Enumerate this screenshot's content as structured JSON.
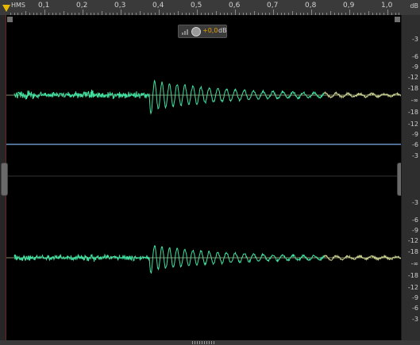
{
  "ruler": {
    "unit": "HMS",
    "ticks": [
      "0,1",
      "0,2",
      "0,3",
      "0,4",
      "0,5",
      "0,6",
      "0,7",
      "0,8",
      "0,9",
      "1,0"
    ]
  },
  "hud": {
    "volume_value": "+0,0",
    "volume_unit": "dB",
    "icons": [
      "volume-bars-icon",
      "volume-knob-icon"
    ]
  },
  "db_scale": {
    "unit": "dB",
    "channel_labels": [
      "-3",
      "-6",
      "-9",
      "-12",
      "-18",
      "-∞",
      "-18",
      "-12",
      "-9",
      "-6",
      "-3"
    ]
  },
  "colors": {
    "waveform": "#3fe0a0",
    "waveform_tail": "#c8d090",
    "center_line": "#8a8a6a",
    "divider": "#6a90c0",
    "playhead": "#e6b800",
    "ruler_bg": "#3a3a3a",
    "canvas_bg": "#000000"
  }
}
